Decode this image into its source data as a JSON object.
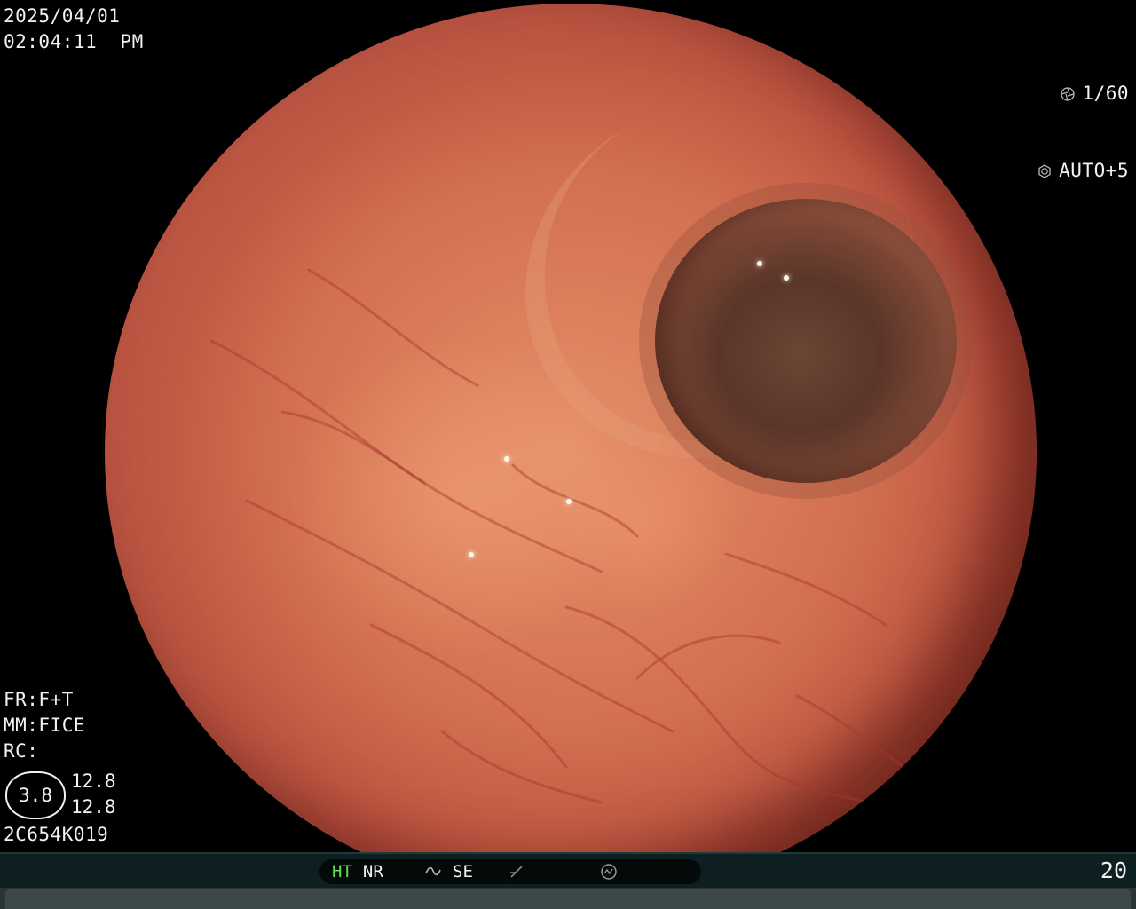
{
  "overlay": {
    "date": "2025/04/01",
    "time": "02:04:11  PM",
    "shutter": "1/60",
    "exposure": "AUTO+5",
    "fr": "FR:F+T",
    "mm": "MM:FICE",
    "rc": "RC:",
    "zoom": "3.8",
    "zoom_top": "12.8",
    "zoom_bottom": "12.8",
    "serial": "2C654K019"
  },
  "status_bar": {
    "ht": "HT",
    "nr": "NR",
    "se": "SE",
    "counter": "20",
    "icons": [
      "tilde-wave-icon",
      "slash-icon",
      "gauge-icon"
    ]
  },
  "colors": {
    "ht_accent": "#62e04e",
    "status_bg": "#0d1f20"
  }
}
